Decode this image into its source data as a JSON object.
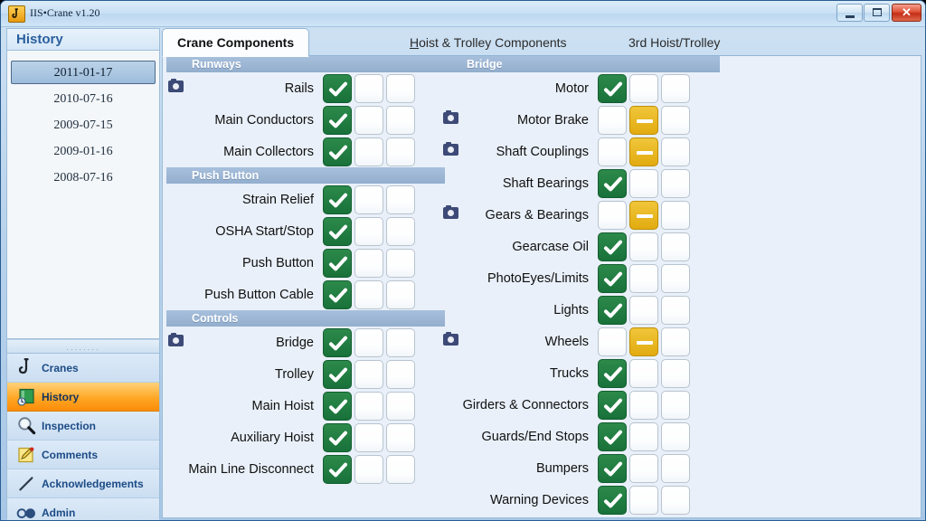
{
  "window": {
    "title": "IIS•Crane v1.20",
    "icon": "crane-hook-icon",
    "controls": {
      "minimize": "minimize-button",
      "maximize": "maximize-button",
      "close_label": "✕"
    }
  },
  "sidebar": {
    "header": "History",
    "history": [
      {
        "date": "2011-01-17",
        "selected": true
      },
      {
        "date": "2010-07-16",
        "selected": false
      },
      {
        "date": "2009-07-15",
        "selected": false
      },
      {
        "date": "2009-01-16",
        "selected": false
      },
      {
        "date": "2008-07-16",
        "selected": false
      }
    ],
    "splitter_grip": "········",
    "nav": [
      {
        "label": "Cranes",
        "icon": "hook-icon",
        "selected": false
      },
      {
        "label": "History",
        "icon": "calendar-icon",
        "selected": true
      },
      {
        "label": "Inspection",
        "icon": "magnifier-icon",
        "selected": false
      },
      {
        "label": "Comments",
        "icon": "pencil-note-icon",
        "selected": false
      },
      {
        "label": "Acknowledgements",
        "icon": "pen-icon",
        "selected": false
      },
      {
        "label": "Admin",
        "icon": "glasses-icon",
        "selected": false
      }
    ]
  },
  "tabs": [
    {
      "label": "Crane Components",
      "accel": "",
      "active": true
    },
    {
      "label": "oist & Trolley Components",
      "accel": "H",
      "active": false
    },
    {
      "label": "3rd Hoist/Trolley",
      "accel": "",
      "active": false
    }
  ],
  "colors": {
    "ok": "#18713a",
    "warn": "#e2ab10",
    "section_header": "#93aecd",
    "panel_bg": "#e9f0f9",
    "nav_selected": "#ffa726",
    "accent": "#1c4b86"
  },
  "legend": {
    "states": [
      "ok",
      "warn",
      "none"
    ],
    "ok_glyph": "check",
    "warn_glyph": "dash"
  },
  "columns": [
    {
      "name": "left",
      "sections": [
        {
          "title": "Runways",
          "rows": [
            {
              "label": "Rails",
              "state": "ok",
              "camera": true
            },
            {
              "label": "Main Conductors",
              "state": "ok",
              "camera": false
            },
            {
              "label": "Main Collectors",
              "state": "ok",
              "camera": false
            }
          ]
        },
        {
          "title": "Push Button",
          "rows": [
            {
              "label": "Strain Relief",
              "state": "ok",
              "camera": false
            },
            {
              "label": "OSHA Start/Stop",
              "state": "ok",
              "camera": false
            },
            {
              "label": "Push Button",
              "state": "ok",
              "camera": false
            },
            {
              "label": "Push Button Cable",
              "state": "ok",
              "camera": false
            }
          ]
        },
        {
          "title": "Controls",
          "rows": [
            {
              "label": "Bridge",
              "state": "ok",
              "camera": true
            },
            {
              "label": "Trolley",
              "state": "ok",
              "camera": false
            },
            {
              "label": "Main Hoist",
              "state": "ok",
              "camera": false
            },
            {
              "label": "Auxiliary Hoist",
              "state": "ok",
              "camera": false
            },
            {
              "label": "Main Line Disconnect",
              "state": "ok",
              "camera": false
            }
          ]
        }
      ]
    },
    {
      "name": "right",
      "sections": [
        {
          "title": "Bridge",
          "rows": [
            {
              "label": "Motor",
              "state": "ok",
              "camera": false
            },
            {
              "label": "Motor Brake",
              "state": "warn",
              "camera": true
            },
            {
              "label": "Shaft Couplings",
              "state": "warn",
              "camera": true
            },
            {
              "label": "Shaft Bearings",
              "state": "ok",
              "camera": false
            },
            {
              "label": "Gears & Bearings",
              "state": "warn",
              "camera": true
            },
            {
              "label": "Gearcase Oil",
              "state": "ok",
              "camera": false
            },
            {
              "label": "PhotoEyes/Limits",
              "state": "ok",
              "camera": false
            },
            {
              "label": "Lights",
              "state": "ok",
              "camera": false
            },
            {
              "label": "Wheels",
              "state": "warn",
              "camera": true
            },
            {
              "label": "Trucks",
              "state": "ok",
              "camera": false
            },
            {
              "label": "Girders & Connectors",
              "state": "ok",
              "camera": false
            },
            {
              "label": "Guards/End Stops",
              "state": "ok",
              "camera": false
            },
            {
              "label": "Bumpers",
              "state": "ok",
              "camera": false
            },
            {
              "label": "Warning Devices",
              "state": "ok",
              "camera": false
            }
          ]
        }
      ]
    }
  ]
}
